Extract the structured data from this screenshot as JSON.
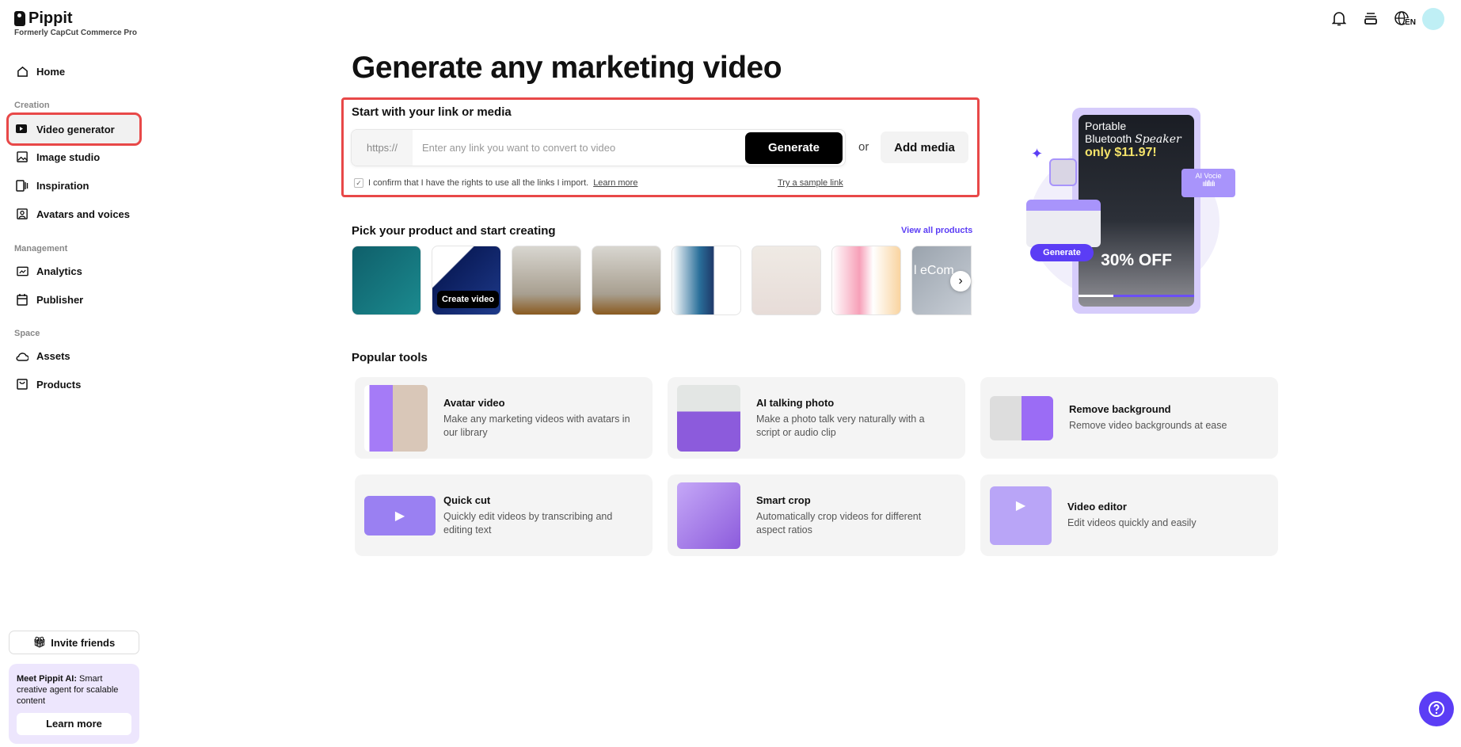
{
  "brand": {
    "name": "Pippit",
    "subtitle": "Formerly CapCut Commerce Pro"
  },
  "sidebar": {
    "home": "Home",
    "sections": {
      "creation": "Creation",
      "management": "Management",
      "space": "Space"
    },
    "items": [
      "Video generator",
      "Image studio",
      "Inspiration",
      "Avatars and voices",
      "Analytics",
      "Publisher",
      "Assets",
      "Products"
    ],
    "invite": "Invite friends",
    "promo": {
      "bold": "Meet Pippit AI:",
      "text": " Smart creative agent for scalable content",
      "button": "Learn more"
    }
  },
  "header": {
    "language": "EN"
  },
  "main": {
    "title": "Generate any marketing video",
    "link_section": {
      "heading": "Start with your link or media",
      "prefix": "https://",
      "placeholder": "Enter any link you want to convert to video",
      "generate": "Generate",
      "or": "or",
      "add_media": "Add media",
      "confirm": "I confirm that I have the rights to use all the links I import.",
      "learn_more": "Learn more",
      "sample": "Try a sample link"
    },
    "products": {
      "heading": "Pick your product and start creating",
      "view_all": "View all products",
      "create_video": "Create video",
      "last_thumb_text": "l eCom"
    },
    "hero": {
      "line1": "Portable",
      "line2": "Bluetooth",
      "line2_italic": "Speaker",
      "price": "only $11.97!",
      "discount": "30% OFF",
      "ai_voice": "AI Vocie",
      "generate": "Generate"
    },
    "popular": {
      "heading": "Popular tools",
      "tools": [
        {
          "title": "Avatar video",
          "desc": "Make any marketing videos with avatars in our library"
        },
        {
          "title": "AI talking photo",
          "desc": "Make a photo talk very naturally with a script or audio clip"
        },
        {
          "title": "Remove background",
          "desc": "Remove video backgrounds at ease"
        },
        {
          "title": "Quick cut",
          "desc": "Quickly edit videos by transcribing and editing text"
        },
        {
          "title": "Smart crop",
          "desc": "Automatically crop videos for different aspect ratios"
        },
        {
          "title": "Video editor",
          "desc": "Edit videos quickly and easily"
        }
      ]
    }
  },
  "colors": {
    "accent": "#5b3df5",
    "highlight": "#e84848",
    "promo_bg": "#ede6fd"
  }
}
